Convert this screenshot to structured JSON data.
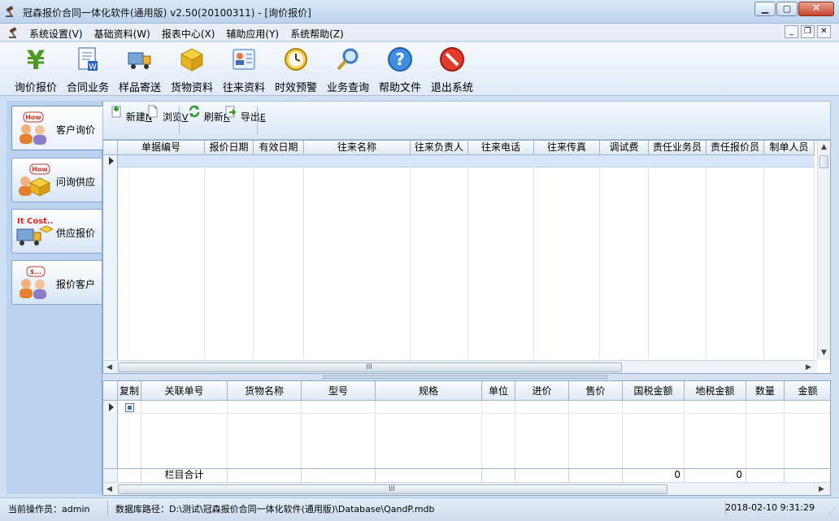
{
  "window": {
    "title": "冠森报价合同一体化软件(通用版) v2.50(20100311) - [询价报价]"
  },
  "menu": [
    "系统设置(V)",
    "基础资料(W)",
    "报表中心(X)",
    "辅助应用(Y)",
    "系统帮助(Z)"
  ],
  "toolbar": [
    {
      "label": "询价报价",
      "icon": "yen-icon"
    },
    {
      "label": "合同业务",
      "icon": "contract-document-icon"
    },
    {
      "label": "样品寄送",
      "icon": "delivery-truck-icon"
    },
    {
      "label": "货物资料",
      "icon": "cargo-box-icon"
    },
    {
      "label": "往来资料",
      "icon": "contacts-card-icon"
    },
    {
      "label": "时效预警",
      "icon": "clock-icon"
    },
    {
      "label": "业务查询",
      "icon": "magnifier-icon"
    },
    {
      "label": "帮助文件",
      "icon": "help-icon"
    },
    {
      "label": "退出系统",
      "icon": "exit-icon"
    }
  ],
  "leftnav": [
    {
      "label": "客户询价",
      "badge": "How",
      "icon": "customer-inquiry-icon"
    },
    {
      "label": "问询供应",
      "badge": "How",
      "icon": "supplier-inquiry-icon"
    },
    {
      "label": "供应报价",
      "badge": "It Cost...",
      "icon": "supplier-quote-icon"
    },
    {
      "label": "报价客户",
      "badge": "$...",
      "icon": "customer-quote-icon"
    }
  ],
  "subtoolbar": [
    {
      "label": "新建",
      "key": "N",
      "icon": "new-doc-icon"
    },
    {
      "label": "浏览",
      "key": "V",
      "icon": "browse-doc-icon"
    },
    {
      "label": "刷新",
      "key": "R",
      "icon": "refresh-icon"
    },
    {
      "label": "导出",
      "key": "E",
      "icon": "export-icon"
    }
  ],
  "main_grid": {
    "columns": [
      "单据编号",
      "报价日期",
      "有效日期",
      "往来名称",
      "往来负责人",
      "往来电话",
      "往来传真",
      "调试费",
      "责任业务员",
      "责任报价员",
      "制单人员"
    ]
  },
  "detail_grid": {
    "columns": [
      "复制",
      "关联单号",
      "货物名称",
      "型号",
      "规格",
      "单位",
      "进价",
      "售价",
      "国税金额",
      "地税金额",
      "数量",
      "金额"
    ],
    "total_label": "栏目合计",
    "total_guoshui": "0",
    "total_dishui": "0"
  },
  "statusbar": {
    "operator": "当前操作员：admin",
    "db_path": "数据库路径：D:\\测试\\冠森报价合同一体化软件(通用版)\\Database\\QandP.mdb",
    "datetime": "2018-02-10 9:31:29"
  },
  "scroll_grip": "III",
  "colors": {
    "accent": "#3c6fb4",
    "selection": "#d5e5fa"
  }
}
